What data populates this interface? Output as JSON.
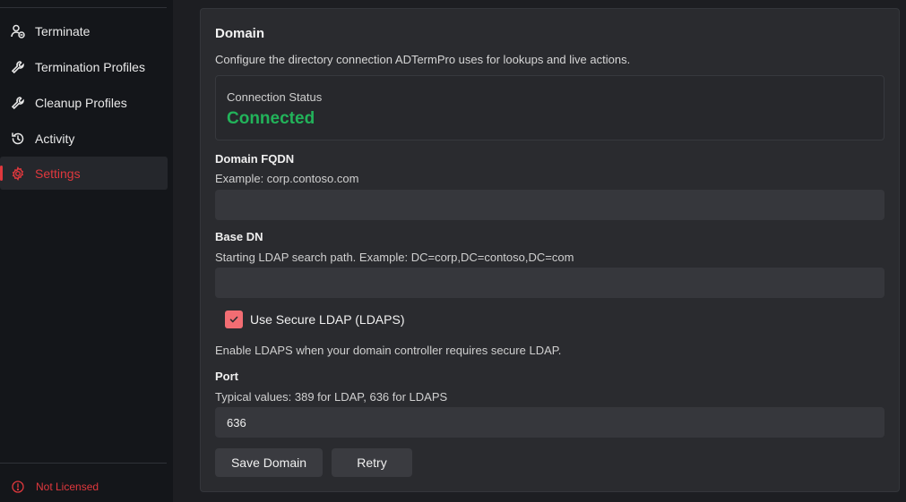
{
  "sidebar": {
    "items": [
      {
        "label": "Terminate",
        "icon": "user-remove-icon"
      },
      {
        "label": "Termination Profiles",
        "icon": "wrench-icon"
      },
      {
        "label": "Cleanup Profiles",
        "icon": "wrench-icon"
      },
      {
        "label": "Activity",
        "icon": "history-icon"
      },
      {
        "label": "Settings",
        "icon": "gear-icon",
        "active": true
      }
    ],
    "license_status": "Not Licensed"
  },
  "domain": {
    "title": "Domain",
    "description": "Configure the directory connection ADTermPro uses for lookups and live actions.",
    "connection_status_label": "Connection Status",
    "connection_status_value": "Connected",
    "fqdn_label": "Domain FQDN",
    "fqdn_help": "Example: corp.contoso.com",
    "fqdn_value": "",
    "base_dn_label": "Base DN",
    "base_dn_help": "Starting LDAP search path. Example: DC=corp,DC=contoso,DC=com",
    "base_dn_value": "",
    "ldaps_label": "Use Secure LDAP (LDAPS)",
    "ldaps_checked": true,
    "ldaps_help": "Enable LDAPS when your domain controller requires secure LDAP.",
    "port_label": "Port",
    "port_help": "Typical values: 389 for LDAP, 636 for LDAPS",
    "port_value": "636",
    "save_label": "Save Domain",
    "retry_label": "Retry"
  },
  "colors": {
    "accent": "#e0383d",
    "connected": "#22b35a",
    "checkbox": "#f26d73"
  }
}
